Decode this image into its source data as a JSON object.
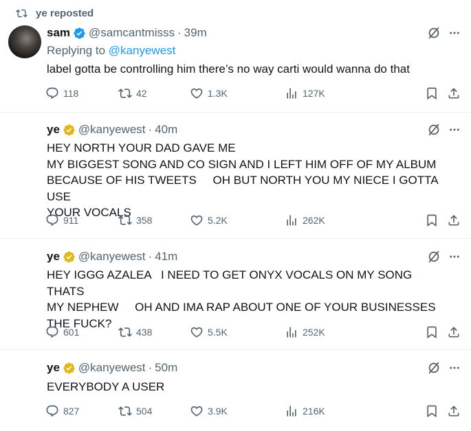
{
  "colors": {
    "text": "#0f1419",
    "muted": "#536471",
    "link": "#1d9bf0",
    "verified_blue": "#1d9bf0",
    "verified_gold": "#e2b719",
    "divider": "#eff3f4"
  },
  "tweets": [
    {
      "repost_label": "ye reposted",
      "name": "sam",
      "verified": "blue",
      "handle": "@samcantmisss",
      "sep": "·",
      "time": "39m",
      "replying_prefix": "Replying to ",
      "replying_to": "@kanyewest",
      "text": "label gotta be controlling him there’s no way carti would wanna do that",
      "replies": "118",
      "reposts": "42",
      "likes": "1.3K",
      "views": "127K"
    },
    {
      "name": "ye",
      "verified": "gold",
      "handle": "@kanyewest",
      "sep": "·",
      "time": "40m",
      "text": "HEY NORTH YOUR DAD GAVE ME\nMY BIGGEST SONG AND CO SIGN AND I LEFT HIM OFF OF MY ALBUM\nBECAUSE OF HIS TWEETS     OH BUT NORTH YOU MY NIECE I GOTTA USE\nYOUR VOCALS",
      "replies": "911",
      "reposts": "358",
      "likes": "5.2K",
      "views": "262K"
    },
    {
      "name": "ye",
      "verified": "gold",
      "handle": "@kanyewest",
      "sep": "·",
      "time": "41m",
      "text": "HEY IGGG AZALEA   I NEED TO GET ONYX VOCALS ON MY SONG    THATS\nMY NEPHEW     OH AND IMA RAP ABOUT ONE OF YOUR BUSINESSES\nTHE FUCK?",
      "replies": "601",
      "reposts": "438",
      "likes": "5.5K",
      "views": "252K"
    },
    {
      "name": "ye",
      "verified": "gold",
      "handle": "@kanyewest",
      "sep": "·",
      "time": "50m",
      "text": "EVERYBODY A USER",
      "replies": "827",
      "reposts": "504",
      "likes": "3.9K",
      "views": "216K"
    }
  ]
}
